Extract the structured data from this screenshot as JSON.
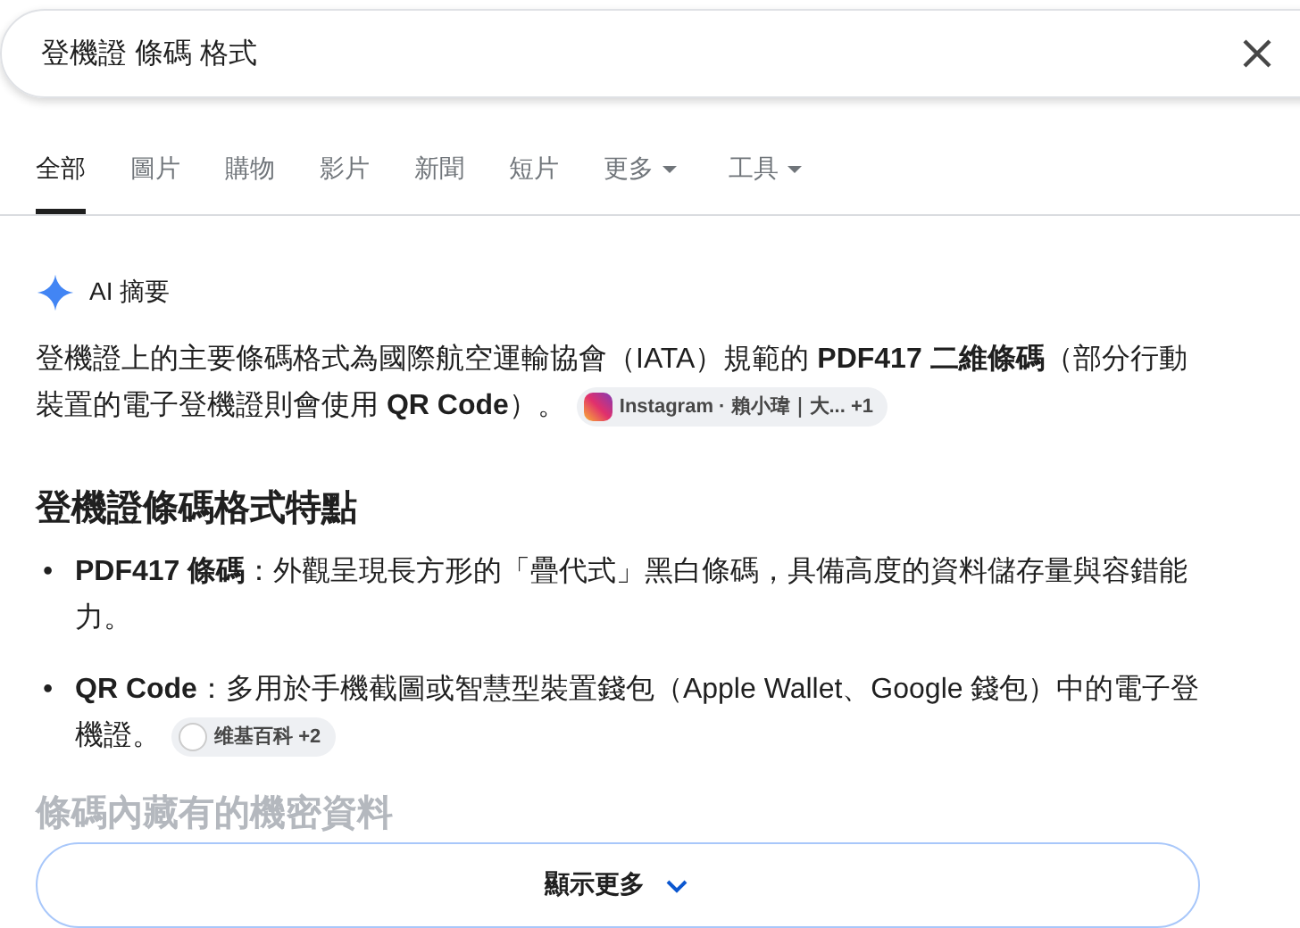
{
  "search": {
    "value": "登機證 條碼 格式"
  },
  "tabs": [
    {
      "label": "全部",
      "selected": true,
      "dropdown": false
    },
    {
      "label": "圖片",
      "selected": false,
      "dropdown": false
    },
    {
      "label": "購物",
      "selected": false,
      "dropdown": false
    },
    {
      "label": "影片",
      "selected": false,
      "dropdown": false
    },
    {
      "label": "新聞",
      "selected": false,
      "dropdown": false
    },
    {
      "label": "短片",
      "selected": false,
      "dropdown": false
    },
    {
      "label": "更多",
      "selected": false,
      "dropdown": true
    },
    {
      "label": "工具",
      "selected": false,
      "dropdown": true
    }
  ],
  "ai_overview": {
    "title": "AI 摘要",
    "summary": "登機證上的主要條碼格式為國際航空運輸協會（IATA）規範的 **PDF417 二維條碼**（部分行動裝置的電子登機證則會使用 **QR Code**）。",
    "summary_source": {
      "kind": "instagram",
      "label": "Instagram · 賴小瑋｜大...",
      "count": "+1"
    },
    "heading": "登機證條碼格式特點",
    "bullets": [
      {
        "marker": "•",
        "text": "**PDF417 條碼**：外觀呈現長方形的「疊代式」黑白條碼，具備高度的資料儲存量與容錯能力。"
      },
      {
        "marker": "•",
        "text": "**QR Code**：多用於手機截圖或智慧型裝置錢包（Apple Wallet、Google 錢包）中的電子登機證。",
        "source": {
          "kind": "wikipedia",
          "label": "维基百科",
          "count": "+2"
        }
      }
    ],
    "faded_heading": "條碼內藏有的機密資料",
    "show_more": "顯示更多"
  }
}
